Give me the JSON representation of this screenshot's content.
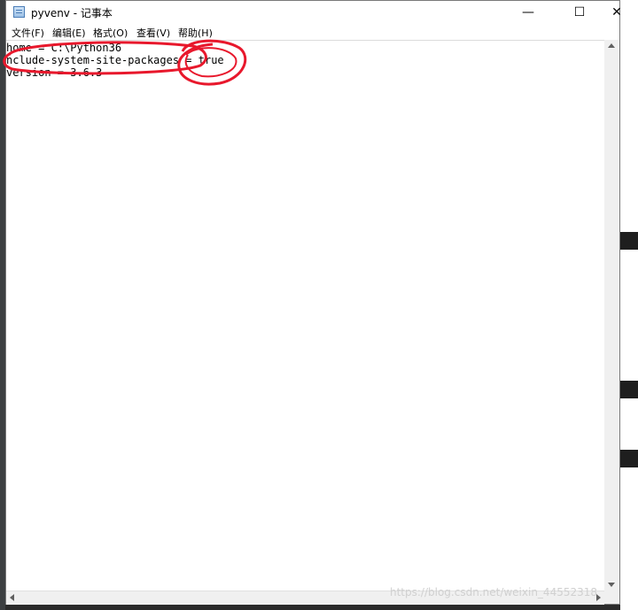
{
  "window": {
    "title": "pyvenv - 记事本",
    "controls": {
      "minimize": "—",
      "maximize": "☐",
      "close": "✕"
    }
  },
  "menu": {
    "items": [
      "文件(F)",
      "编辑(E)",
      "格式(O)",
      "查看(V)",
      "帮助(H)"
    ]
  },
  "editor": {
    "lines": [
      "home = C:\\Python36",
      "nclude-system-site-packages = true",
      "version = 3.6.3"
    ]
  },
  "watermark": "https://blog.csdn.net/weixin_44552318",
  "colors": {
    "annotation": "#e8182c"
  }
}
